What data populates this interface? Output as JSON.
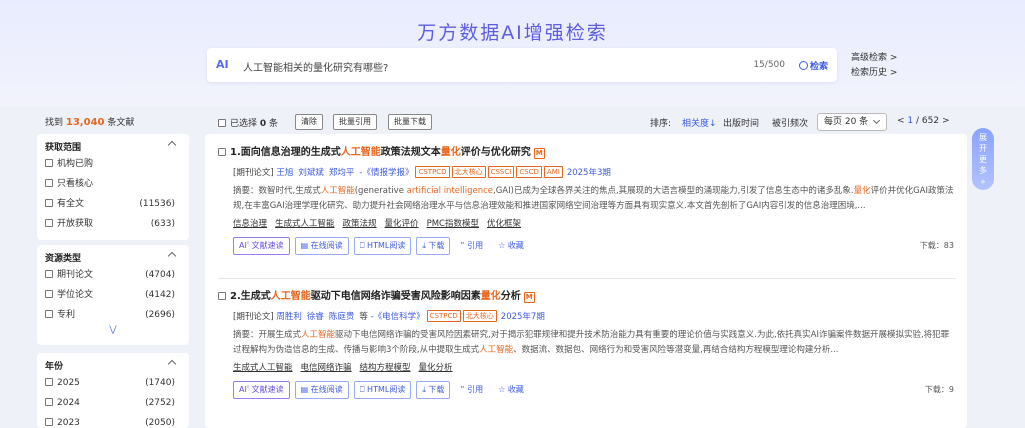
{
  "header": {
    "title": "万方数据AI增强检索",
    "search_ai_mark": "AI",
    "search_query": "人工智能相关的量化研究有哪些?",
    "search_count": "15/500",
    "search_button": "检索",
    "advanced_search": "高级检索 >",
    "search_history": "检索历史 >"
  },
  "summary": {
    "prefix": "找到",
    "count": "13,040",
    "suffix": "条文献"
  },
  "facets": [
    {
      "title": "获取范围",
      "items": [
        {
          "label": "机构已购",
          "count": ""
        },
        {
          "label": "只看核心",
          "count": ""
        },
        {
          "label": "有全文",
          "count": "(11536)"
        },
        {
          "label": "开放获取",
          "count": "(633)"
        }
      ]
    },
    {
      "title": "资源类型",
      "items": [
        {
          "label": "期刊论文",
          "count": "(4704)"
        },
        {
          "label": "学位论文",
          "count": "(4142)"
        },
        {
          "label": "专利",
          "count": "(2696)"
        }
      ]
    },
    {
      "title": "年份",
      "items": [
        {
          "label": "2025",
          "count": "(1740)"
        },
        {
          "label": "2024",
          "count": "(2752)"
        },
        {
          "label": "2023",
          "count": "(2050)"
        }
      ]
    }
  ],
  "toolbar": {
    "selected_prefix": "已选择",
    "selected_count": "0",
    "selected_suffix": "条",
    "clear": "清除",
    "batch_cite": "批量引用",
    "batch_download": "批量下载",
    "sort_label": "排序:",
    "sort_relevance": "相关度↓",
    "sort_date": "出版时间",
    "sort_cited": "被引频次",
    "per_page": "每页 20 条",
    "pager_prev": "<",
    "pager_current": "1",
    "pager_total": "/ 652",
    "pager_next": ">"
  },
  "results": [
    {
      "index": "1.",
      "title_parts": [
        {
          "t": "面向信息治理的生成式",
          "hl": false
        },
        {
          "t": "人工智能",
          "hl": true
        },
        {
          "t": "政策法规文本",
          "hl": false
        },
        {
          "t": "量化",
          "hl": true
        },
        {
          "t": "评价与优化研究",
          "hl": false
        }
      ],
      "badge": "M",
      "type": "[期刊论文]",
      "authors": [
        "王旭",
        "刘斌斌",
        "郑均平"
      ],
      "authors_suffix": "",
      "source": "-《情报学报》",
      "tags": [
        "CSTPCD",
        "北大核心",
        "CSSCI",
        "CSCD",
        "AMI"
      ],
      "year": "2025年3期",
      "abstract_parts": [
        {
          "t": "摘要：数智时代,生成式",
          "c": ""
        },
        {
          "t": "人工智能",
          "c": "hl"
        },
        {
          "t": "(generative ",
          "c": ""
        },
        {
          "t": "artificial intelligence",
          "c": "en"
        },
        {
          "t": ",GAI)已成为全球各界关注的焦点,其展现的大语言模型的涌现能力,引发了信息生态中的诸多乱象.",
          "c": ""
        },
        {
          "t": "量化",
          "c": "hl"
        },
        {
          "t": "评价并优化GAI政策法规,在丰富GAI治理学理化研究、助力提升社会网络治理水平与信息治理效能和推进国家网络空间治理等方面具有现实意义.本文首先剖析了GAI内容引发的信息治理困境,...",
          "c": ""
        }
      ],
      "keywords": [
        "信息治理",
        "生成式人工智能",
        "政策法规",
        "量化评价",
        "PMC指数模型",
        "优化框架"
      ],
      "actions": {
        "ai": "文献速读",
        "read": "在线阅读",
        "html": "HTML阅读",
        "download": "下载",
        "cite": "引用",
        "fav": "收藏"
      },
      "downloads": "下载：83"
    },
    {
      "index": "2.",
      "title_parts": [
        {
          "t": "生成式",
          "hl": false
        },
        {
          "t": "人工智能",
          "hl": true
        },
        {
          "t": "驱动下电信网络诈骗受害风险影响因素",
          "hl": false
        },
        {
          "t": "量化",
          "hl": true
        },
        {
          "t": "分析",
          "hl": false
        }
      ],
      "badge": "M",
      "type": "[期刊论文]",
      "authors": [
        "周胜利",
        "徐睿",
        "陈庭贵"
      ],
      "authors_suffix": "等",
      "source": "-《电信科学》",
      "tags": [
        "CSTPCD",
        "北大核心"
      ],
      "year": "2025年7期",
      "abstract_parts": [
        {
          "t": "摘要：开展生成式",
          "c": ""
        },
        {
          "t": "人工智能",
          "c": "hl"
        },
        {
          "t": "驱动下电信网络诈骗的受害风险因素研究,对于揭示犯罪规律和提升技术防治能力具有重要的理论价值与实践意义.为此,依托真实AI诈骗案件数据开展模拟实验,将犯罪过程解构为伪造信息的生成、传播与影响3个阶段,从中提取生成式",
          "c": ""
        },
        {
          "t": "人工智能",
          "c": "hl"
        },
        {
          "t": "、数据流、数据包、网络行为和受害风险等潜变量,再结合结构方程模型理论构建分析...",
          "c": ""
        }
      ],
      "keywords": [
        "生成式人工智能",
        "电信网络诈骗",
        "结构方程模型",
        "量化分析"
      ],
      "actions": {
        "ai": "文献速读",
        "read": "在线阅读",
        "html": "HTML阅读",
        "download": "下载",
        "cite": "引用",
        "fav": "收藏"
      },
      "downloads": "下载：9"
    }
  ],
  "float_tab": "展开更多",
  "colors": {
    "accent": "#3d5be0",
    "highlight": "#e8661d",
    "title": "#5b5fe0"
  }
}
